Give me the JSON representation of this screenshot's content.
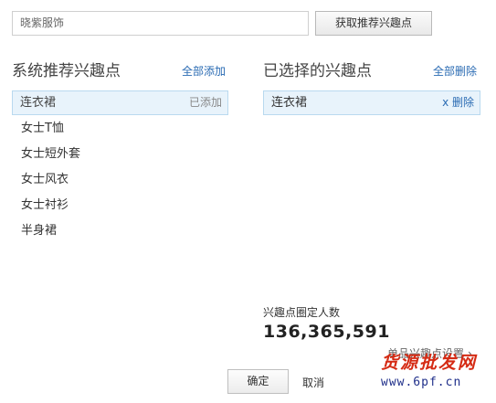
{
  "search": {
    "value": "晓紫服饰"
  },
  "fetch_button": {
    "label": "获取推荐兴趣点"
  },
  "recommended": {
    "title": "系统推荐兴趣点",
    "add_all": "全部添加",
    "active_item": {
      "label": "连衣裙",
      "status": "已添加"
    },
    "items": [
      "女士T恤",
      "女士短外套",
      "女士风衣",
      "女士衬衫",
      "半身裙"
    ]
  },
  "selected": {
    "title": "已选择的兴趣点",
    "remove_all": "全部删除",
    "items": [
      {
        "label": "连衣裙",
        "action": "x 删除"
      }
    ]
  },
  "audience": {
    "label": "兴趣点圈定人数",
    "value": "136,365,591"
  },
  "single_setting": {
    "label": "单品兴趣点设置",
    "chevron": "›"
  },
  "footer": {
    "ok": "确定",
    "cancel": "取消"
  },
  "watermark": {
    "text": "货源批发网",
    "url": "www.6pf.cn"
  },
  "colors": {
    "accent_link": "#2a6bb3",
    "selected_bg": "#e8f3fb",
    "selected_border": "#b9d9ef"
  }
}
